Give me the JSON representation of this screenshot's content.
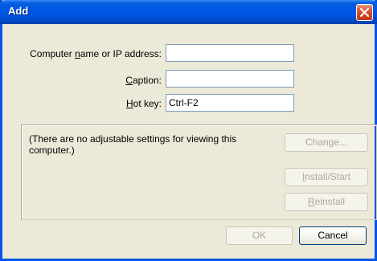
{
  "window": {
    "title": "Add"
  },
  "fields": {
    "computer": {
      "label_pre": "Computer ",
      "label_acc": "n",
      "label_post": "ame or IP address:",
      "value": ""
    },
    "caption": {
      "label_pre": "",
      "label_acc": "C",
      "label_post": "aption:",
      "value": ""
    },
    "hotkey": {
      "label_pre": "",
      "label_acc": "H",
      "label_post": "ot key:",
      "value": "Ctrl-F2"
    }
  },
  "panel": {
    "note_line1": "(There are no adjustable settings for viewing this",
    "note_line2": "computer.)",
    "change_label": "Change...",
    "install_pre": "",
    "install_acc": "I",
    "install_post": "nstall/Start",
    "reinstall_pre": "",
    "reinstall_acc": "R",
    "reinstall_post": "einstall"
  },
  "footer": {
    "ok_label": "OK",
    "cancel_label": "Cancel"
  },
  "colors": {
    "titlebar": "#0054e3",
    "frame": "#0055e5",
    "dialog_bg": "#ece9d8",
    "close": "#d8532e"
  }
}
